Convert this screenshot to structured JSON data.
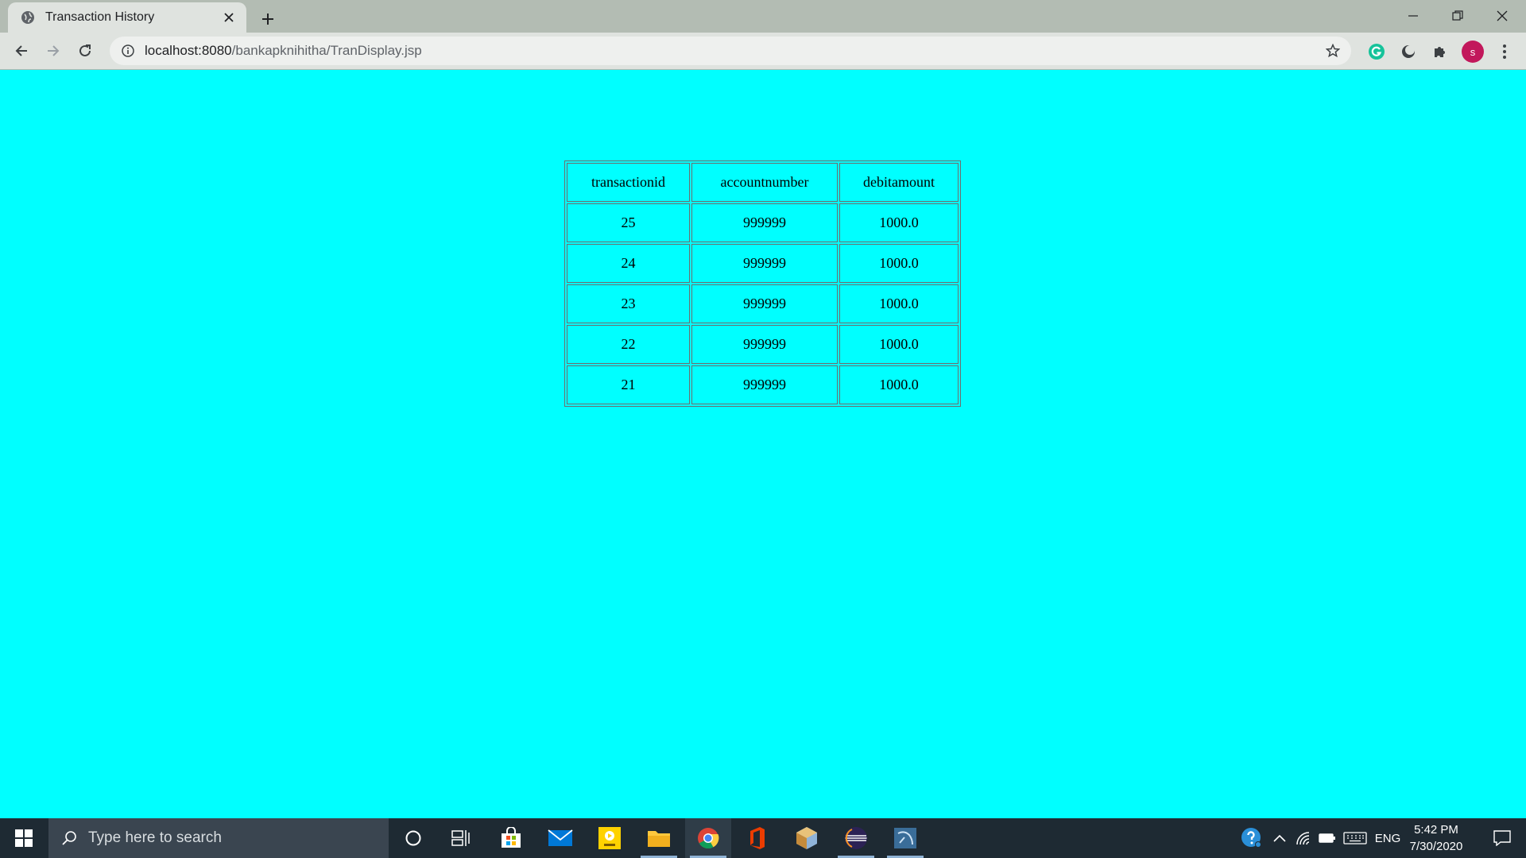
{
  "browser": {
    "tab_title": "Transaction History",
    "url_host": "localhost:8080",
    "url_path": "/bankapknihitha/TranDisplay.jsp",
    "avatar_letter": "s"
  },
  "table": {
    "headers": [
      "transactionid",
      "accountnumber",
      "debitamount"
    ],
    "rows": [
      [
        "25",
        "999999",
        "1000.0"
      ],
      [
        "24",
        "999999",
        "1000.0"
      ],
      [
        "23",
        "999999",
        "1000.0"
      ],
      [
        "22",
        "999999",
        "1000.0"
      ],
      [
        "21",
        "999999",
        "1000.0"
      ]
    ]
  },
  "taskbar": {
    "search_placeholder": "Type here to search",
    "language": "ENG",
    "time": "5:42 PM",
    "date": "7/30/2020",
    "pinned_apps": [
      "cortana-icon",
      "task-view-icon",
      "store-icon",
      "mail-icon",
      "player-icon",
      "file-explorer-icon",
      "chrome-icon",
      "office-icon",
      "box-app-icon",
      "eclipse-icon",
      "workbench-icon"
    ]
  },
  "colors": {
    "page_background": "#00ffff",
    "tabstrip": "#b3bcb3",
    "toolbar": "#dfe3df",
    "taskbar": "#1e2a33",
    "avatar": "#c2185b"
  }
}
